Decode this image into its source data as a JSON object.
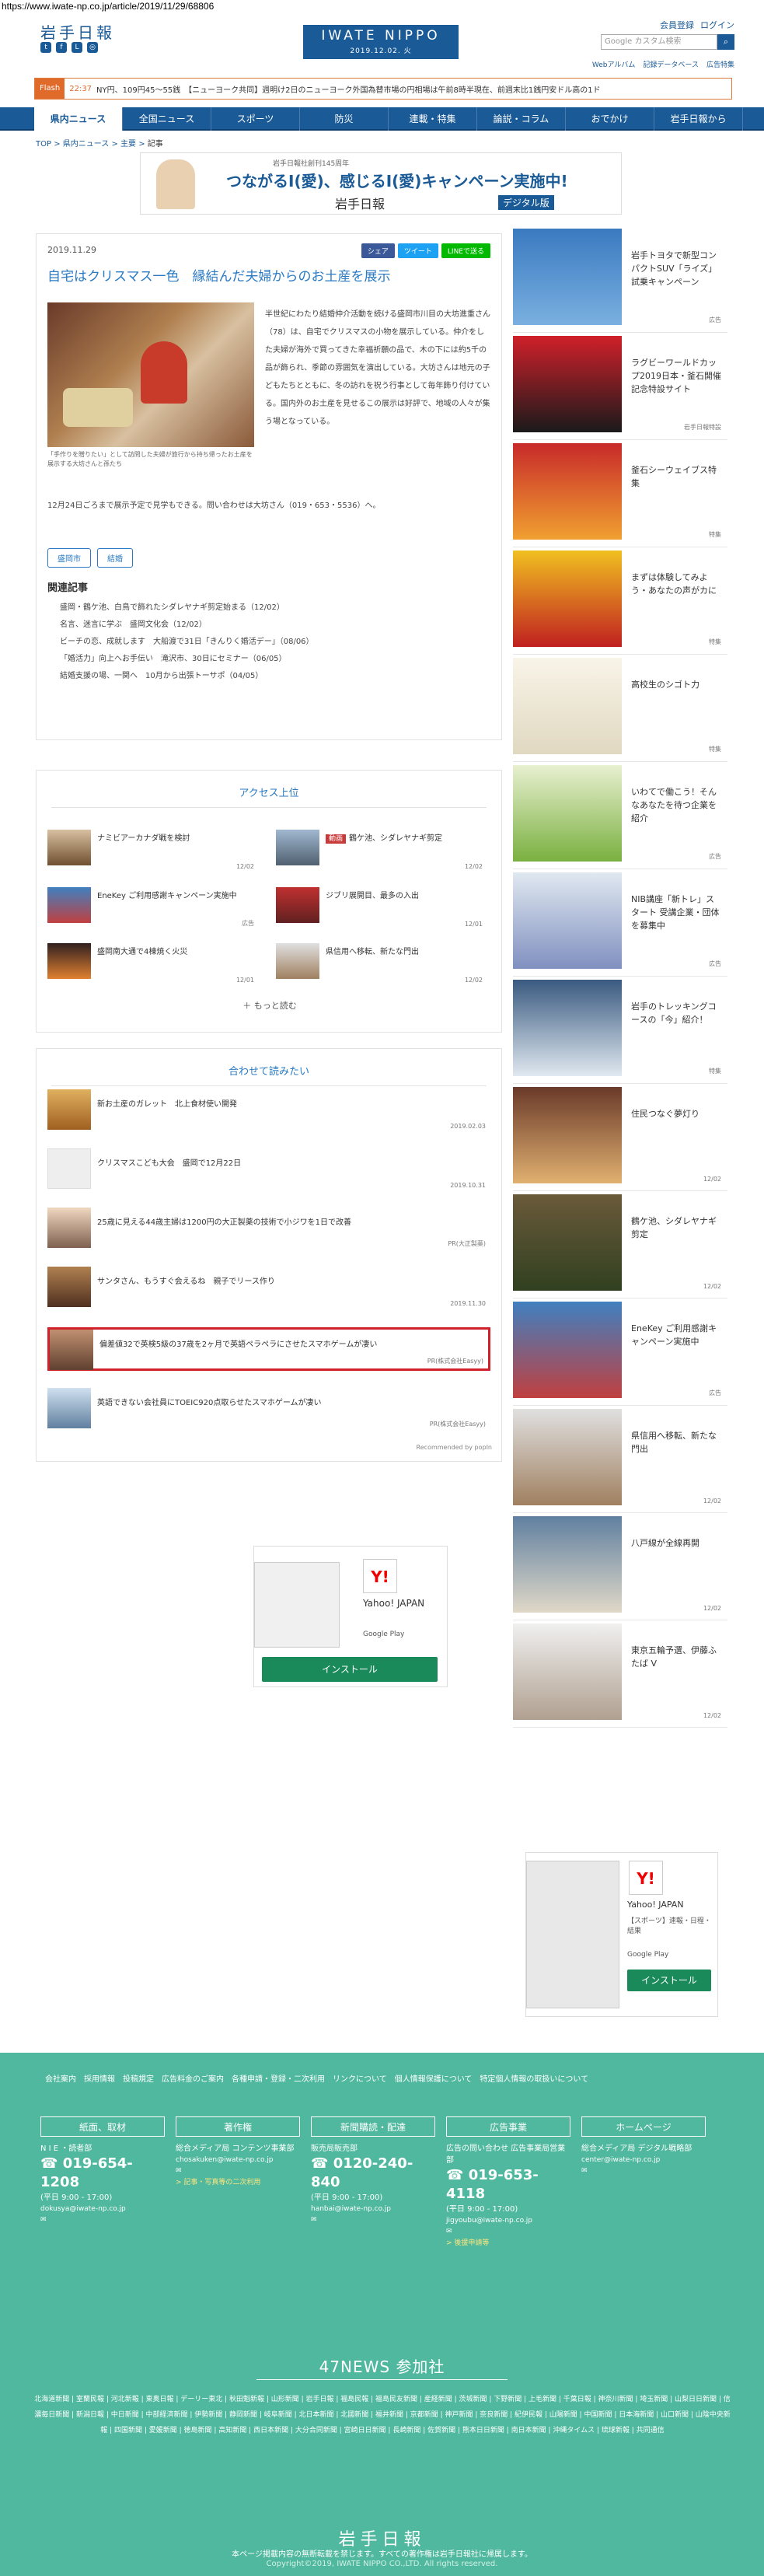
{
  "url": "https://www.iwate-np.co.jp/article/2019/11/29/68806",
  "header": {
    "logo": "岩手日報",
    "brand": "IWATE NIPPO",
    "date": "2019.12.02. 火",
    "links": [
      "会員登録",
      "ログイン"
    ],
    "search_placeholder": "Google カスタム検索",
    "sublinks": [
      "Webアルバム",
      "記録データベース",
      "広告特集"
    ]
  },
  "flash": {
    "label": "Flash",
    "time": "22:37",
    "text": "NY円、109円45～55銭　【ニューヨーク共同】週明け2日のニューヨーク外国為替市場の円相場は午前8時半現在、前週末比1銭円安ドル高の1ド"
  },
  "nav": [
    "県内ニュース",
    "全国ニュース",
    "スポーツ",
    "防災",
    "連載・特集",
    "論説・コラム",
    "おでかけ",
    "岩手日報から"
  ],
  "breadcrumb": [
    "TOP",
    "県内ニュース",
    "主要",
    "記事"
  ],
  "banner": {
    "line1": "岩手日報社創刊145周年",
    "line2": "つながるI(愛)、感じるI(愛)キャンペーン実施中!",
    "line3": "岩手日報",
    "line4": "デジタル版"
  },
  "article": {
    "date": "2019.11.29",
    "share": [
      "シェア",
      "ツイート",
      "LINEで送る"
    ],
    "title": "自宅はクリスマス一色　縁結んだ夫婦からのお土産を展示",
    "caption": "「手作りを贈りたい」として訪問した夫婦が旅行から持ち帰ったお土産を展示する大坊さんと孫たち",
    "body1": "半世紀にわたり結婚仲介活動を続ける盛岡市川目の大坊進重さん（78）は、自宅でクリスマスの小物を展示している。仲介をした夫婦が海外で買ってきた幸福祈願の品で、木の下には約5千の品が飾られ、季節の雰囲気を演出している。大坊さんは地元の子どもたちとともに、冬の訪れを祝う行事として毎年飾り付けている。国内外のお土産を見せるこの展示は好評で、地域の人々が集う場となっている。",
    "body2": "12月24日ごろまで展示予定で見学もできる。問い合わせは大坊さん（019・653・5536）へ。",
    "tags": [
      "盛岡市",
      "結婚"
    ],
    "related_heading": "関連記事",
    "related": [
      "盛岡・鶴ケ池、白鳥で飾れたシダレヤナギ剪定始まる（12/02）",
      "名言、迷言に学ぶ　盛岡文化会（12/02）",
      "ビーチの恋、成就します　大船渡で31日「きんりく婚活デー」（08/06）",
      "「婚活力」向上へお手伝い　滝沢市、30日にセミナー（06/05）",
      "結婚支援の場、一関へ　10月から出張トーサポ（04/05）"
    ]
  },
  "ranking": {
    "heading": "アクセス上位",
    "items": [
      {
        "text": "ナミビアーカナダ戦を検討",
        "date": "12/02",
        "badge": ""
      },
      {
        "text": "鶴ケ池、シダレヤナギ剪定",
        "date": "12/02",
        "badge": "動画"
      },
      {
        "text": "EneKey ご利用感謝キャンペーン実施中",
        "date": "広告",
        "badge": ""
      },
      {
        "text": "ジブリ展開目、最多の入出",
        "date": "12/01",
        "badge": ""
      },
      {
        "text": "盛岡南大通で4棟焼く火災",
        "date": "12/01",
        "badge": ""
      },
      {
        "text": "県信用へ移転、新たな門出",
        "date": "12/02",
        "badge": ""
      }
    ],
    "more": "もっと読む"
  },
  "recommend": {
    "heading": "合わせて読みたい",
    "items": [
      {
        "text": "新お土産のガレット　北上食材使い開発",
        "date": "2019.02.03"
      },
      {
        "text": "クリスマスこども大会　盛岡で12月22日",
        "date": "2019.10.31"
      },
      {
        "text": "25歳に見える44歳主婦は1200円の大正製薬の技術で小ジワを1日で改善",
        "date": "PR(大正製薬)"
      },
      {
        "text": "サンタさん、もうすぐ会えるね　親子でリース作り",
        "date": "2019.11.30"
      },
      {
        "text": "偏差値32で英検5級の37歳を2ヶ月で英語ペラペラにさせたスマホゲームが凄い",
        "date": "PR(株式会社Easyy)"
      },
      {
        "text": "英語できない会社員にTOEIC920点取らせたスマホゲームが凄い",
        "date": "PR(株式会社Easyy)"
      }
    ],
    "recommended_by": "Recommended by popIn"
  },
  "ads": {
    "yahoo_name": "Yahoo! JAPAN",
    "play": "Google Play",
    "install": "インストール",
    "yahoo_sub": "【スポーツ】速報・日程・結果"
  },
  "sidebar": [
    {
      "text": "岩手トヨタで新型コンパクトSUV「ライズ」試乗キャンペーン",
      "label": "広告"
    },
    {
      "text": "ラグビーワールドカップ2019日本・釜石開催記念特設サイト",
      "label": "岩手日報特設"
    },
    {
      "text": "釜石シーウェイブス特集",
      "label": "特集"
    },
    {
      "text": "まずは体験してみよう・あなたの声がカに",
      "label": "特集"
    },
    {
      "text": "高校生のシゴト力",
      "label": "特集"
    },
    {
      "text": "いわてで働こう！そんなあなたを待つ企業を紹介",
      "label": "広告"
    },
    {
      "text": "NIB講座「新トレ」スタート 受講企業・団体を募集中",
      "label": "広告"
    },
    {
      "text": "岩手のトレッキングコースの「今」紹介！",
      "label": "特集"
    },
    {
      "text": "住民つなぐ夢灯り",
      "label": "12/02"
    },
    {
      "text": "鶴ケ池、シダレヤナギ剪定",
      "label": "12/02"
    },
    {
      "text": "EneKey ご利用感謝キャンペーン実施中",
      "label": "広告"
    },
    {
      "text": "県信用へ移転、新たな門出",
      "label": "12/02"
    },
    {
      "text": "八戸線が全線再開",
      "label": "12/02"
    },
    {
      "text": "東京五輪予選、伊藤ふたば V",
      "label": "12/02"
    }
  ],
  "footer": {
    "links": "会社案内　採用情報　投稿規定　広告料金のご案内　各種申請・登録・二次利用　リンクについて　個人情報保護について　特定個人情報の取扱いについて",
    "cols": [
      {
        "head": "紙面、取材",
        "l1": "N I E ・読者部",
        "phone": "019-654-1208",
        "hours": "(平日 9:00 - 17:00)",
        "mail": "dokusya@iwate-np.co.jp",
        "extra": ""
      },
      {
        "head": "著作権",
        "l1": "総合メディア局 コンテンツ事業部",
        "phone": "",
        "hours": "",
        "mail": "chosakuken@iwate-np.co.jp",
        "extra": "> 記事・写真等の二次利用"
      },
      {
        "head": "新聞購読・配達",
        "l1": "販売局販売部",
        "phone": "0120-240-840",
        "hours": "(平日 9:00 - 17:00)",
        "mail": "hanbai@iwate-np.co.jp",
        "extra": ""
      },
      {
        "head": "広告事業",
        "l1": "広告の問い合わせ 広告事業局営業部",
        "phone": "019-653-4118",
        "hours": "(平日 9:00 - 17:00)",
        "mail": "jigyoubu@iwate-np.co.jp",
        "extra": "> 後援申請等"
      },
      {
        "head": "ホームページ",
        "l1": "総合メディア局 デジタル戦略部",
        "phone": "",
        "hours": "",
        "mail": "center@iwate-np.co.jp",
        "extra": ""
      }
    ],
    "n47": "47NEWS 参加社",
    "papers": "北海道新聞 | 室蘭民報 | 河北新報 | 東奥日報 | デーリー東北 | 秋田魁新報 | 山形新聞 | 岩手日報 | 福島民報 | 福島民友新聞 | 産経新聞 | 茨城新聞 | 下野新聞 | 上毛新聞 | 千葉日報 | 神奈川新聞 | 埼玉新聞 | 山梨日日新聞 | 信濃毎日新聞 | 新潟日報 | 中日新聞 | 中部経済新聞 | 伊勢新聞 | 静岡新聞 | 岐阜新聞 | 北日本新聞 | 北國新聞 | 福井新聞 | 京都新聞 | 神戸新聞 | 奈良新聞 | 紀伊民報 | 山陽新聞 | 中国新聞 | 日本海新聞 | 山口新聞 | 山陰中央新報 | 四国新聞 | 愛媛新聞 | 徳島新聞 | 高知新聞 | 西日本新聞 | 大分合同新聞 | 宮崎日日新聞 | 長崎新聞 | 佐賀新聞 | 熊本日日新聞 | 南日本新聞 | 沖縄タイムス | 琉球新報 | 共同通信",
    "logo": "岩手日報",
    "copy1": "本ページ掲載内容の無断転載を禁じます。すべての著作権は岩手日報社に帰属します。",
    "copy2": "Copyright©2019, IWATE NIPPO CO.,LTD. All rights reserved."
  }
}
